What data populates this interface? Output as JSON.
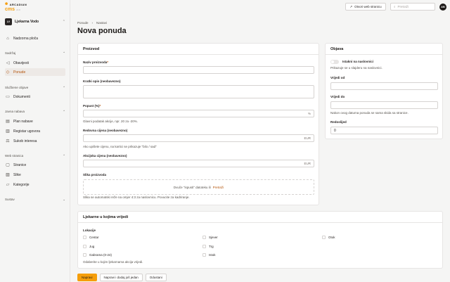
{
  "brand": {
    "name": "ARCADIAN",
    "product": "cms",
    "version": "v1.0"
  },
  "tenant": {
    "initials": "LV",
    "name": "Ljekarna Vodo"
  },
  "sidebar": {
    "dashboard": "Nadzorna ploča",
    "sections": [
      {
        "label": "Sadržaj",
        "items": [
          "Obavijesti",
          "Ponude"
        ]
      },
      {
        "label": "Službene objave",
        "items": [
          "Dokumenti"
        ]
      },
      {
        "label": "Javna nabava",
        "items": [
          "Plan nabave",
          "Registar ugovora",
          "Sukob interesa"
        ]
      },
      {
        "label": "Web stranica",
        "items": [
          "Stranice",
          "Slike",
          "Kategorije"
        ]
      },
      {
        "label": "Sustav",
        "items": []
      }
    ]
  },
  "topbar": {
    "open_site": "Otvori web stranicu",
    "search_placeholder": "Pretraži",
    "user_initials": "AM"
  },
  "breadcrumb": [
    "Ponude",
    "Nastavi"
  ],
  "page_title": "Nova ponuda",
  "main_card": {
    "title": "Proizvod",
    "product_name_label": "Naziv proizvoda",
    "short_desc_label": "Kratki opis (neobavezno)",
    "discount_label": "Popust (%)",
    "discount_suffix": "%",
    "discount_hint": "Glavni podatak akcije, npr. 20 za -20%.",
    "regular_price_label": "Redovna cijena (neobavezno)",
    "regular_price_suffix": "EUR",
    "regular_price_hint": "Ako upišete cijenu, na kartici se prikazuje \"bilo / sad\"",
    "sale_price_label": "Akcijska cijena (neobavezno)",
    "sale_price_suffix": "EUR",
    "image_label": "Slika proizvoda",
    "upload_text": "Dvuče \"ispusti\" datoteku ili",
    "upload_browse": "Pretraži",
    "image_hint": "Slika se automatski reže na omjer 4:3 za naslovnicu. Povucite za kadriranje."
  },
  "publish_card": {
    "title": "Objava",
    "featured_label": "Istakni na naslovnici",
    "featured_hint": "Prikazuje se u slajderu na naslovnici.",
    "valid_from_label": "Vrijedi od",
    "valid_to_label": "Vrijedi do",
    "valid_to_hint": "Nakon ovog datuma ponuda se sama skida sa stranice.",
    "order_label": "Redoslijed",
    "order_value": "0"
  },
  "pharmacies_card": {
    "title": "Ljekarne u kojima vrijedi",
    "locations_label": "Lokacije",
    "locations": [
      "Centar",
      "Sjever",
      "Otok",
      "Jug",
      "Trg",
      "Istok",
      "Gabrama (0-24)"
    ],
    "hint": "Odaberite u kojim ljekarnama akcija vrijedi."
  },
  "actions": {
    "save": "Napravi",
    "save_add": "Napravi i dodaj još jedan",
    "cancel": "Odustani"
  },
  "colors": {
    "accent": "#f59e0b",
    "active_text": "#b45309"
  }
}
